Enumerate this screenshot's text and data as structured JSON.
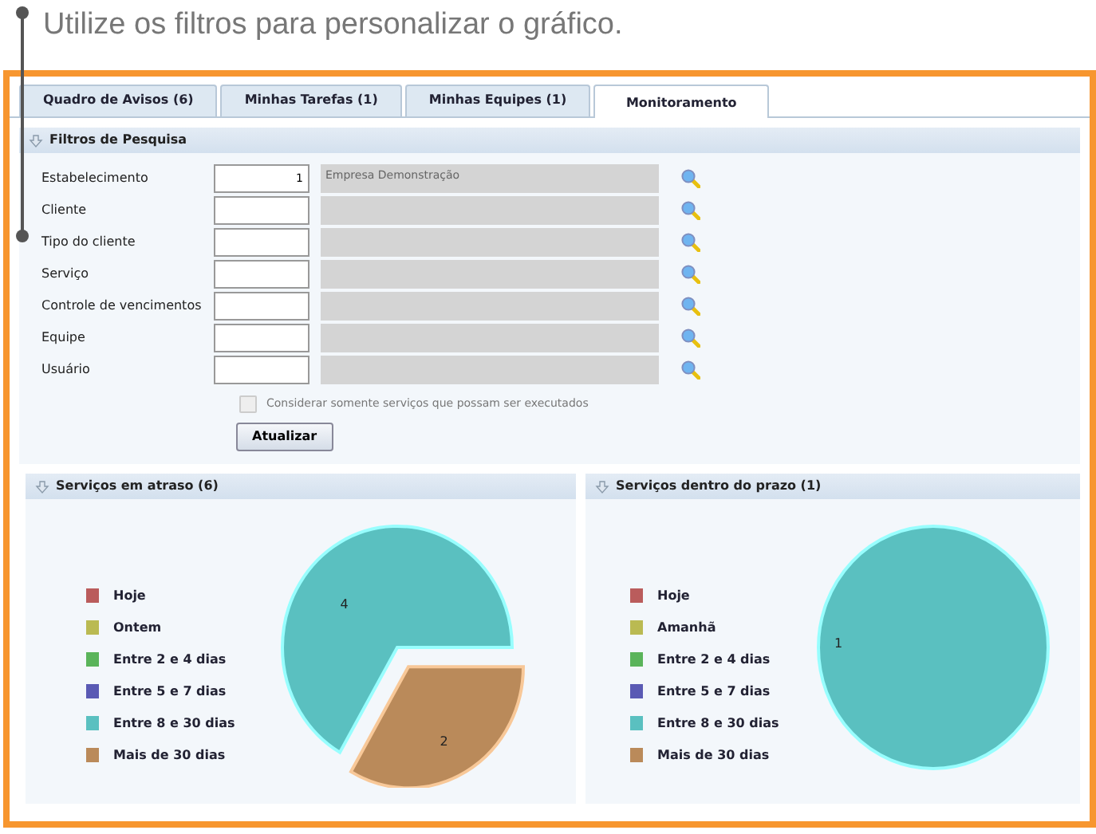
{
  "caption": "Utilize os filtros para personalizar o gráfico.",
  "tabs": [
    {
      "label": "Quadro de Avisos (6)",
      "selected": false
    },
    {
      "label": "Minhas Tarefas (1)",
      "selected": false
    },
    {
      "label": "Minhas Equipes (1)",
      "selected": false
    },
    {
      "label": "Monitoramento",
      "selected": true
    }
  ],
  "filters": {
    "title": "Filtros de Pesquisa",
    "fields": [
      {
        "label": "Estabelecimento",
        "code": "1",
        "description": "Empresa Demonstração"
      },
      {
        "label": "Cliente"
      },
      {
        "label": "Tipo do cliente"
      },
      {
        "label": "Serviço"
      },
      {
        "label": "Controle de vencimentos"
      },
      {
        "label": "Equipe"
      },
      {
        "label": "Usuário"
      }
    ],
    "checkbox": {
      "label": "Considerar somente serviços que possam ser executados",
      "checked": false
    },
    "button": "Atualizar"
  },
  "panels": [
    {
      "title": "Serviços em atraso (6)",
      "chart_data": {
        "type": "pie",
        "categories": [
          "Hoje",
          "Ontem",
          "Entre 2 e 4 dias",
          "Entre 5 e 7 dias",
          "Entre 8 e 30 dias",
          "Mais de 30 dias"
        ],
        "values": [
          0,
          0,
          0,
          0,
          4,
          2
        ],
        "legend": "left",
        "colors": [
          "#f89a9a",
          "#f8f890",
          "#98f298",
          "#9898f2",
          "#98fefe",
          "#f8c898"
        ],
        "data_labels": true
      }
    },
    {
      "title": "Serviços dentro do prazo (1)",
      "chart_data": {
        "type": "pie",
        "categories": [
          "Hoje",
          "Amanhã",
          "Entre 2 e 4 dias",
          "Entre 5 e 7 dias",
          "Entre 8 e 30 dias",
          "Mais de 30 dias"
        ],
        "values": [
          0,
          0,
          0,
          0,
          1,
          0
        ],
        "legend": "left",
        "colors": [
          "#f89a9a",
          "#f8f890",
          "#98f298",
          "#9898f2",
          "#98fefe",
          "#f8c898"
        ],
        "data_labels": true
      }
    }
  ]
}
